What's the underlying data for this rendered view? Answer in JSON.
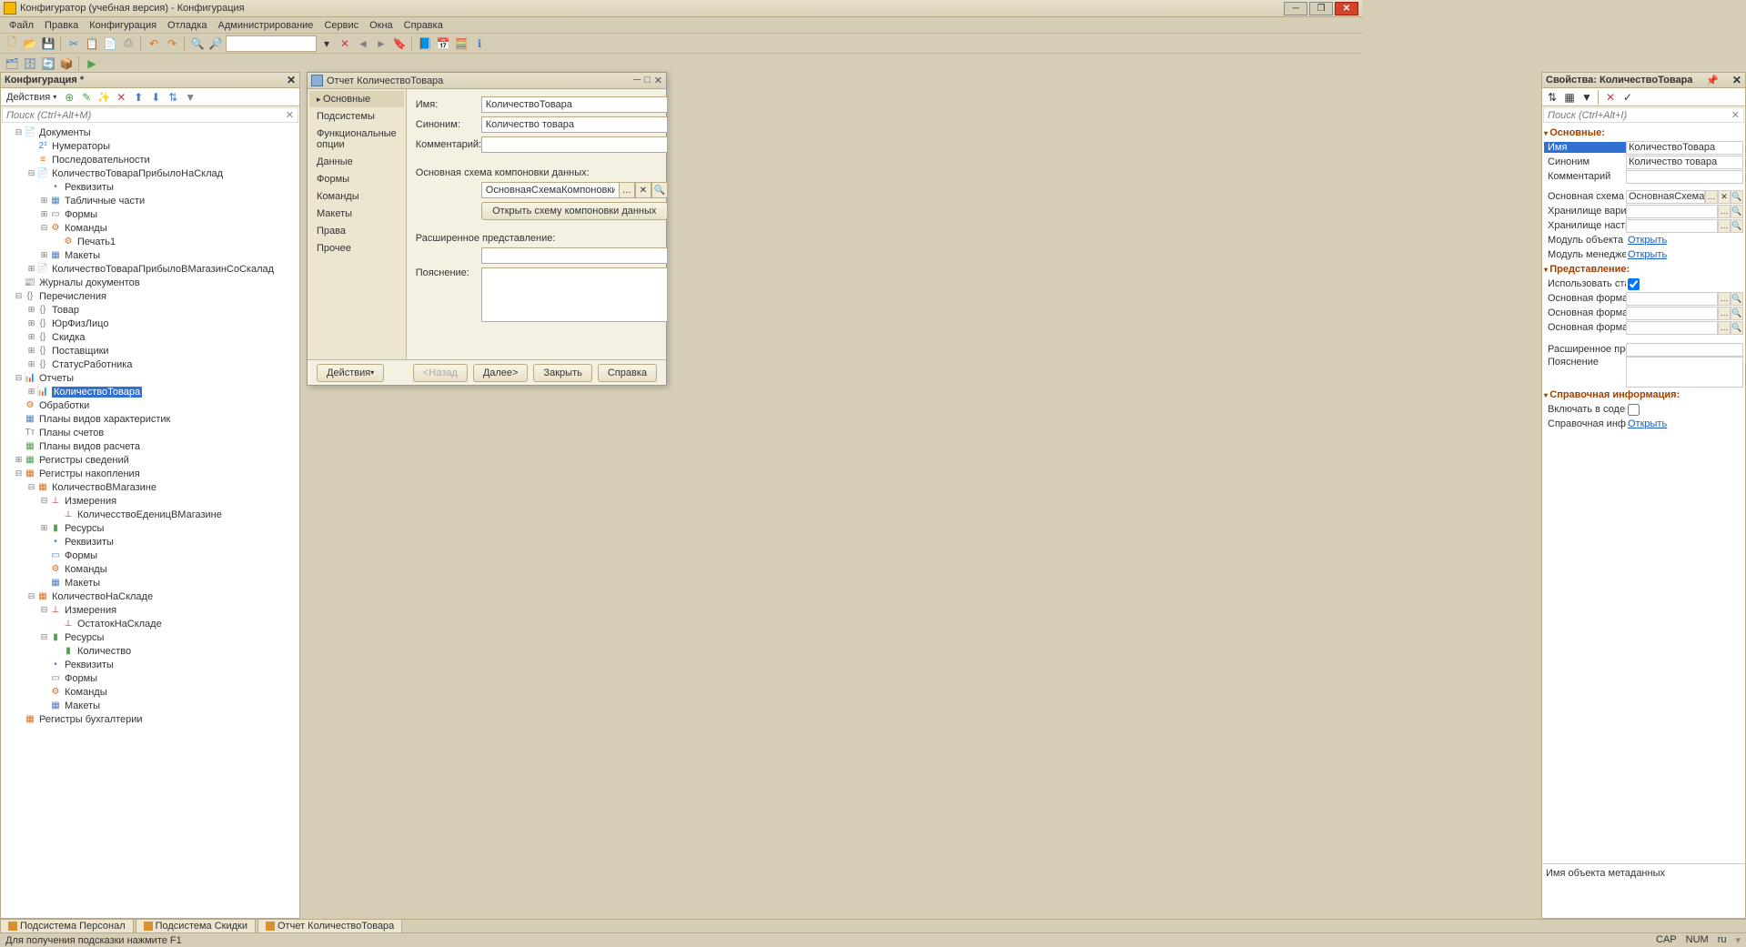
{
  "title": "Конфигуратор (учебная версия) - Конфигурация",
  "menu": [
    "Файл",
    "Правка",
    "Конфигурация",
    "Отладка",
    "Администрирование",
    "Сервис",
    "Окна",
    "Справка"
  ],
  "config_panel": {
    "title": "Конфигурация *",
    "actions": "Действия",
    "search_placeholder": "Поиск (Ctrl+Alt+M)"
  },
  "tree": [
    {
      "lvl": 1,
      "exp": "⊟",
      "ico": "📄",
      "cls": "c-folder",
      "label": "Документы"
    },
    {
      "lvl": 2,
      "exp": "",
      "ico": "2³",
      "cls": "c-blue",
      "label": "Нумераторы"
    },
    {
      "lvl": 2,
      "exp": "",
      "ico": "≡",
      "cls": "c-orange",
      "label": "Последовательности"
    },
    {
      "lvl": 2,
      "exp": "⊟",
      "ico": "📄",
      "cls": "c-folder",
      "label": "КоличествоТовараПрибылоНаСклад"
    },
    {
      "lvl": 3,
      "exp": "",
      "ico": "•",
      "cls": "c-blue",
      "label": "Реквизиты"
    },
    {
      "lvl": 3,
      "exp": "⊞",
      "ico": "▦",
      "cls": "c-blue",
      "label": "Табличные части"
    },
    {
      "lvl": 3,
      "exp": "⊞",
      "ico": "▭",
      "cls": "c-blue",
      "label": "Формы"
    },
    {
      "lvl": 3,
      "exp": "⊟",
      "ico": "⚙",
      "cls": "c-orange",
      "label": "Команды"
    },
    {
      "lvl": 4,
      "exp": "",
      "ico": "⚙",
      "cls": "c-orange",
      "label": "Печать1"
    },
    {
      "lvl": 3,
      "exp": "⊞",
      "ico": "▦",
      "cls": "c-blue",
      "label": "Макеты"
    },
    {
      "lvl": 2,
      "exp": "⊞",
      "ico": "📄",
      "cls": "c-folder",
      "label": "КоличествоТовараПрибылоВМагазинСоСкалад"
    },
    {
      "lvl": 1,
      "exp": "",
      "ico": "📰",
      "cls": "c-orange",
      "label": "Журналы документов"
    },
    {
      "lvl": 1,
      "exp": "⊟",
      "ico": "{}",
      "cls": "c-gray",
      "label": "Перечисления"
    },
    {
      "lvl": 2,
      "exp": "⊞",
      "ico": "{}",
      "cls": "c-gray",
      "label": "Товар"
    },
    {
      "lvl": 2,
      "exp": "⊞",
      "ico": "{}",
      "cls": "c-gray",
      "label": "ЮрФизЛицо"
    },
    {
      "lvl": 2,
      "exp": "⊞",
      "ico": "{}",
      "cls": "c-gray",
      "label": "Скидка"
    },
    {
      "lvl": 2,
      "exp": "⊞",
      "ico": "{}",
      "cls": "c-gray",
      "label": "Поставщики"
    },
    {
      "lvl": 2,
      "exp": "⊞",
      "ico": "{}",
      "cls": "c-gray",
      "label": "СтатусРаботника"
    },
    {
      "lvl": 1,
      "exp": "⊟",
      "ico": "📊",
      "cls": "c-blue",
      "label": "Отчеты"
    },
    {
      "lvl": 2,
      "exp": "⊞",
      "ico": "📊",
      "cls": "c-blue",
      "label": "КоличествоТовара",
      "sel": true
    },
    {
      "lvl": 1,
      "exp": "",
      "ico": "⚙",
      "cls": "c-orange",
      "label": "Обработки"
    },
    {
      "lvl": 1,
      "exp": "",
      "ico": "▦",
      "cls": "c-blue",
      "label": "Планы видов характеристик"
    },
    {
      "lvl": 1,
      "exp": "",
      "ico": "Тт",
      "cls": "c-gray",
      "label": "Планы счетов"
    },
    {
      "lvl": 1,
      "exp": "",
      "ico": "▦",
      "cls": "c-green",
      "label": "Планы видов расчета"
    },
    {
      "lvl": 1,
      "exp": "⊞",
      "ico": "▦",
      "cls": "c-green",
      "label": "Регистры сведений"
    },
    {
      "lvl": 1,
      "exp": "⊟",
      "ico": "▦",
      "cls": "c-orange",
      "label": "Регистры накопления"
    },
    {
      "lvl": 2,
      "exp": "⊟",
      "ico": "▦",
      "cls": "c-orange",
      "label": "КоличествоВМагазине"
    },
    {
      "lvl": 3,
      "exp": "⊟",
      "ico": "⊥",
      "cls": "c-red",
      "label": "Измерения"
    },
    {
      "lvl": 4,
      "exp": "",
      "ico": "⊥",
      "cls": "c-red",
      "label": "КоличесствоЕденицВМагазине"
    },
    {
      "lvl": 3,
      "exp": "⊞",
      "ico": "▮",
      "cls": "c-green",
      "label": "Ресурсы"
    },
    {
      "lvl": 3,
      "exp": "",
      "ico": "•",
      "cls": "c-blue",
      "label": "Реквизиты"
    },
    {
      "lvl": 3,
      "exp": "",
      "ico": "▭",
      "cls": "c-blue",
      "label": "Формы"
    },
    {
      "lvl": 3,
      "exp": "",
      "ico": "⚙",
      "cls": "c-orange",
      "label": "Команды"
    },
    {
      "lvl": 3,
      "exp": "",
      "ico": "▦",
      "cls": "c-blue",
      "label": "Макеты"
    },
    {
      "lvl": 2,
      "exp": "⊟",
      "ico": "▦",
      "cls": "c-orange",
      "label": "КоличествоНаСкладе"
    },
    {
      "lvl": 3,
      "exp": "⊟",
      "ico": "⊥",
      "cls": "c-red",
      "label": "Измерения"
    },
    {
      "lvl": 4,
      "exp": "",
      "ico": "⊥",
      "cls": "c-red",
      "label": "ОстатокНаСкладе"
    },
    {
      "lvl": 3,
      "exp": "⊟",
      "ico": "▮",
      "cls": "c-green",
      "label": "Ресурсы"
    },
    {
      "lvl": 4,
      "exp": "",
      "ico": "▮",
      "cls": "c-green",
      "label": "Количество"
    },
    {
      "lvl": 3,
      "exp": "",
      "ico": "•",
      "cls": "c-blue",
      "label": "Реквизиты"
    },
    {
      "lvl": 3,
      "exp": "",
      "ico": "▭",
      "cls": "c-blue",
      "label": "Формы"
    },
    {
      "lvl": 3,
      "exp": "",
      "ico": "⚙",
      "cls": "c-orange",
      "label": "Команды"
    },
    {
      "lvl": 3,
      "exp": "",
      "ico": "▦",
      "cls": "c-blue",
      "label": "Макеты"
    },
    {
      "lvl": 1,
      "exp": "",
      "ico": "▦",
      "cls": "c-orange",
      "label": "Регистры бухгалтерии"
    }
  ],
  "dialog": {
    "title": "Отчет КоличествоТовара",
    "tabs": [
      "Основные",
      "Подсистемы",
      "Функциональные опции",
      "Данные",
      "Формы",
      "Команды",
      "Макеты",
      "Права",
      "Прочее"
    ],
    "labels": {
      "name": "Имя:",
      "synonym": "Синоним:",
      "comment": "Комментарий:",
      "schema": "Основная схема компоновки данных:",
      "openSchema": "Открыть схему компоновки данных",
      "extRepr": "Расширенное представление:",
      "explain": "Пояснение:"
    },
    "values": {
      "name": "КоличествоТовара",
      "synonym": "Количество товара",
      "comment": "",
      "schema": "ОсновнаяСхемаКомпоновкиДан",
      "extRepr": "",
      "explain": ""
    },
    "footer": {
      "actions": "Действия",
      "back": "<Назад",
      "next": "Далее>",
      "close": "Закрыть",
      "help": "Справка"
    }
  },
  "props": {
    "title": "Свойства: КоличествоТовара",
    "search_placeholder": "Поиск (Ctrl+Alt+I)",
    "sections": {
      "main": "Основные:",
      "repr": "Представление:",
      "ref": "Справочная информация:"
    },
    "rows": {
      "name": {
        "l": "Имя",
        "v": "КоличествоТовара"
      },
      "synonym": {
        "l": "Синоним",
        "v": "Количество товара"
      },
      "comment": {
        "l": "Комментарий",
        "v": ""
      },
      "schema": {
        "l": "Основная схема комп",
        "v": "ОсновнаяСхемаКомпо"
      },
      "varstore": {
        "l": "Хранилище варианто",
        "v": ""
      },
      "setstore": {
        "l": "Хранилище настроек",
        "v": ""
      },
      "modobj": {
        "l": "Модуль объекта",
        "v": "Открыть"
      },
      "modmgr": {
        "l": "Модуль менеджера",
        "v": "Открыть"
      },
      "usestd": {
        "l": "Использовать станда"
      },
      "mainform": {
        "l": "Основная форма",
        "v": ""
      },
      "mainformset": {
        "l": "Основная форма нас",
        "v": ""
      },
      "mainformvar": {
        "l": "Основная форма вар",
        "v": ""
      },
      "extrepr": {
        "l": "Расширенное предст",
        "v": ""
      },
      "explain": {
        "l": "Пояснение",
        "v": ""
      },
      "inclcont": {
        "l": "Включать в содержан"
      },
      "refinfo": {
        "l": "Справочная информа",
        "v": "Открыть"
      }
    },
    "hint": "Имя объекта метаданных"
  },
  "bottom_tabs": [
    "Подсистема Персонал",
    "Подсистема Скидки",
    "Отчет КоличествоТовара"
  ],
  "status": {
    "left": "Для получения подсказки нажмите F1",
    "cap": "CAP",
    "num": "NUM",
    "lang": "ru"
  }
}
